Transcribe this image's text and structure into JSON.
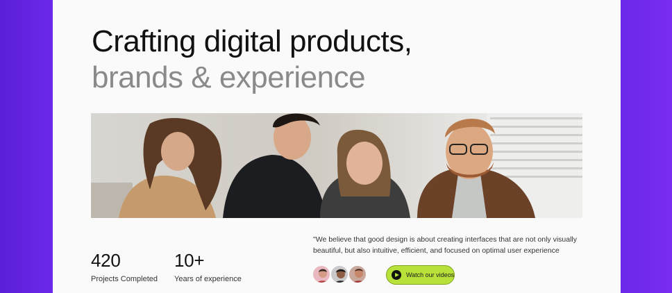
{
  "hero": {
    "title_line1": "Crafting digital products,",
    "title_line2": "brands & experience"
  },
  "stats": [
    {
      "value": "420",
      "label": "Projects Completed"
    },
    {
      "value": "10+",
      "label": "Years of experience"
    }
  ],
  "testimonial": {
    "quote": "\"We believe that good design is about creating interfaces that are not only visually beautiful, but also intuitive, efficient, and focused on optimal user experience"
  },
  "cta": {
    "watch_label": "Watch our videos",
    "icon": "play-icon"
  },
  "colors": {
    "frame": "#6a22e8",
    "card_bg": "#fafafa",
    "accent": "#b8e23a",
    "title_primary": "#111111",
    "title_secondary": "#8a8a8a"
  }
}
